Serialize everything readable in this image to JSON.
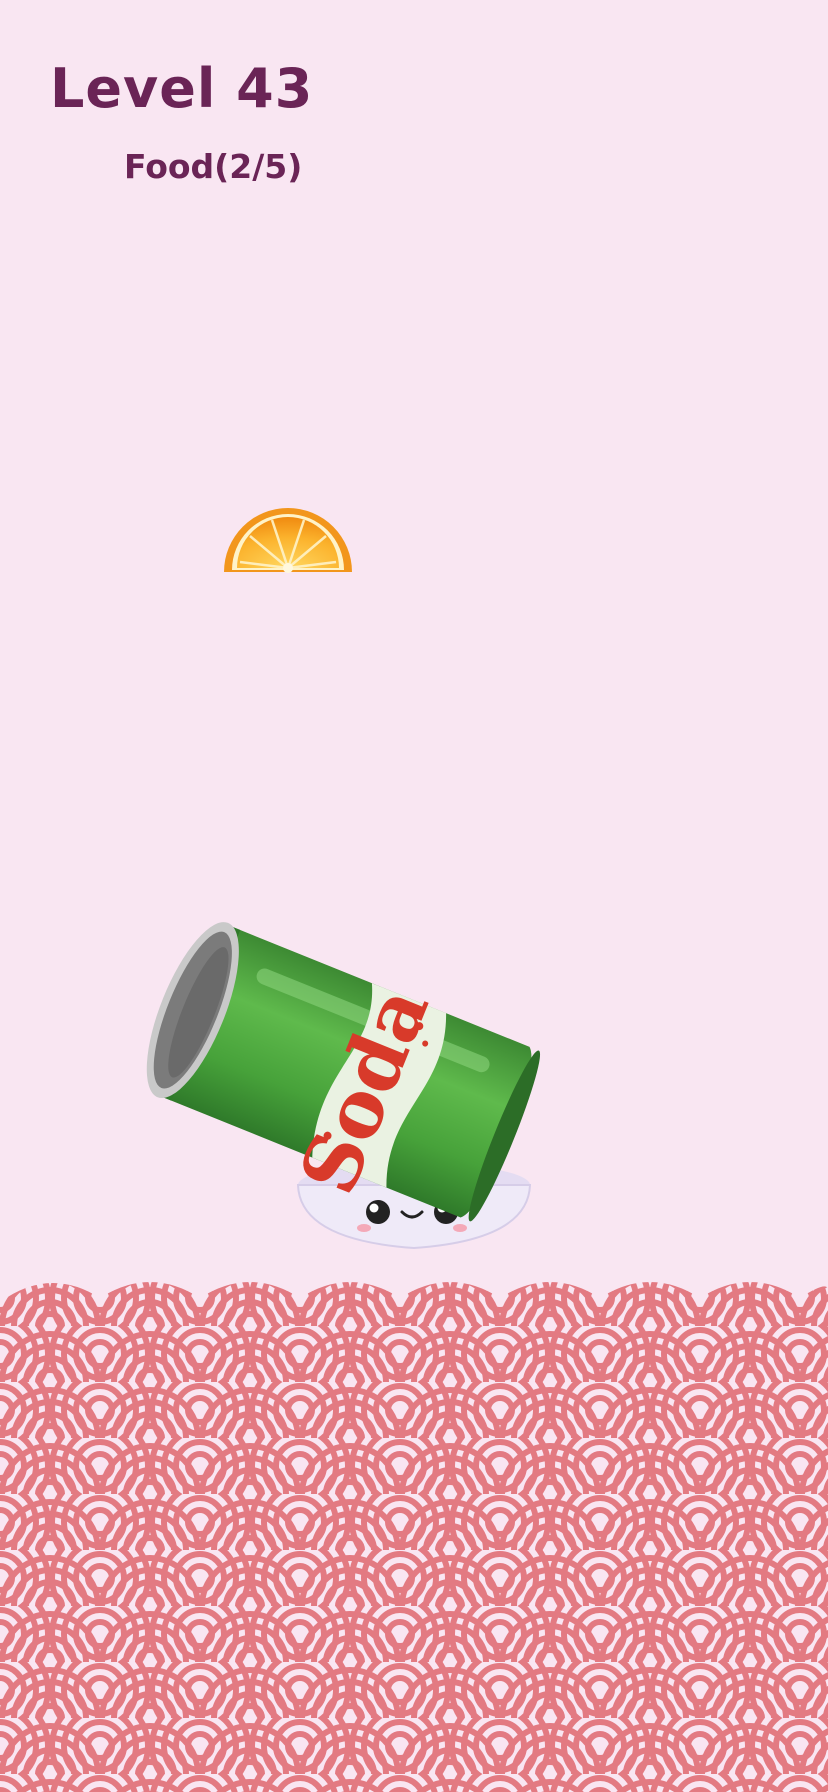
{
  "hud": {
    "level_label": "Level 43",
    "food_progress": "Food(2/5)"
  },
  "items": {
    "falling_food": "orange-slice",
    "container_brand_text": "Soda"
  },
  "colors": {
    "background": "#f9e6f2",
    "title": "#6a2456",
    "wave_pink": "#e37a82",
    "wave_light": "#f9e6f2",
    "can_green": "#4ca83e",
    "soda_red": "#d83a2a"
  }
}
